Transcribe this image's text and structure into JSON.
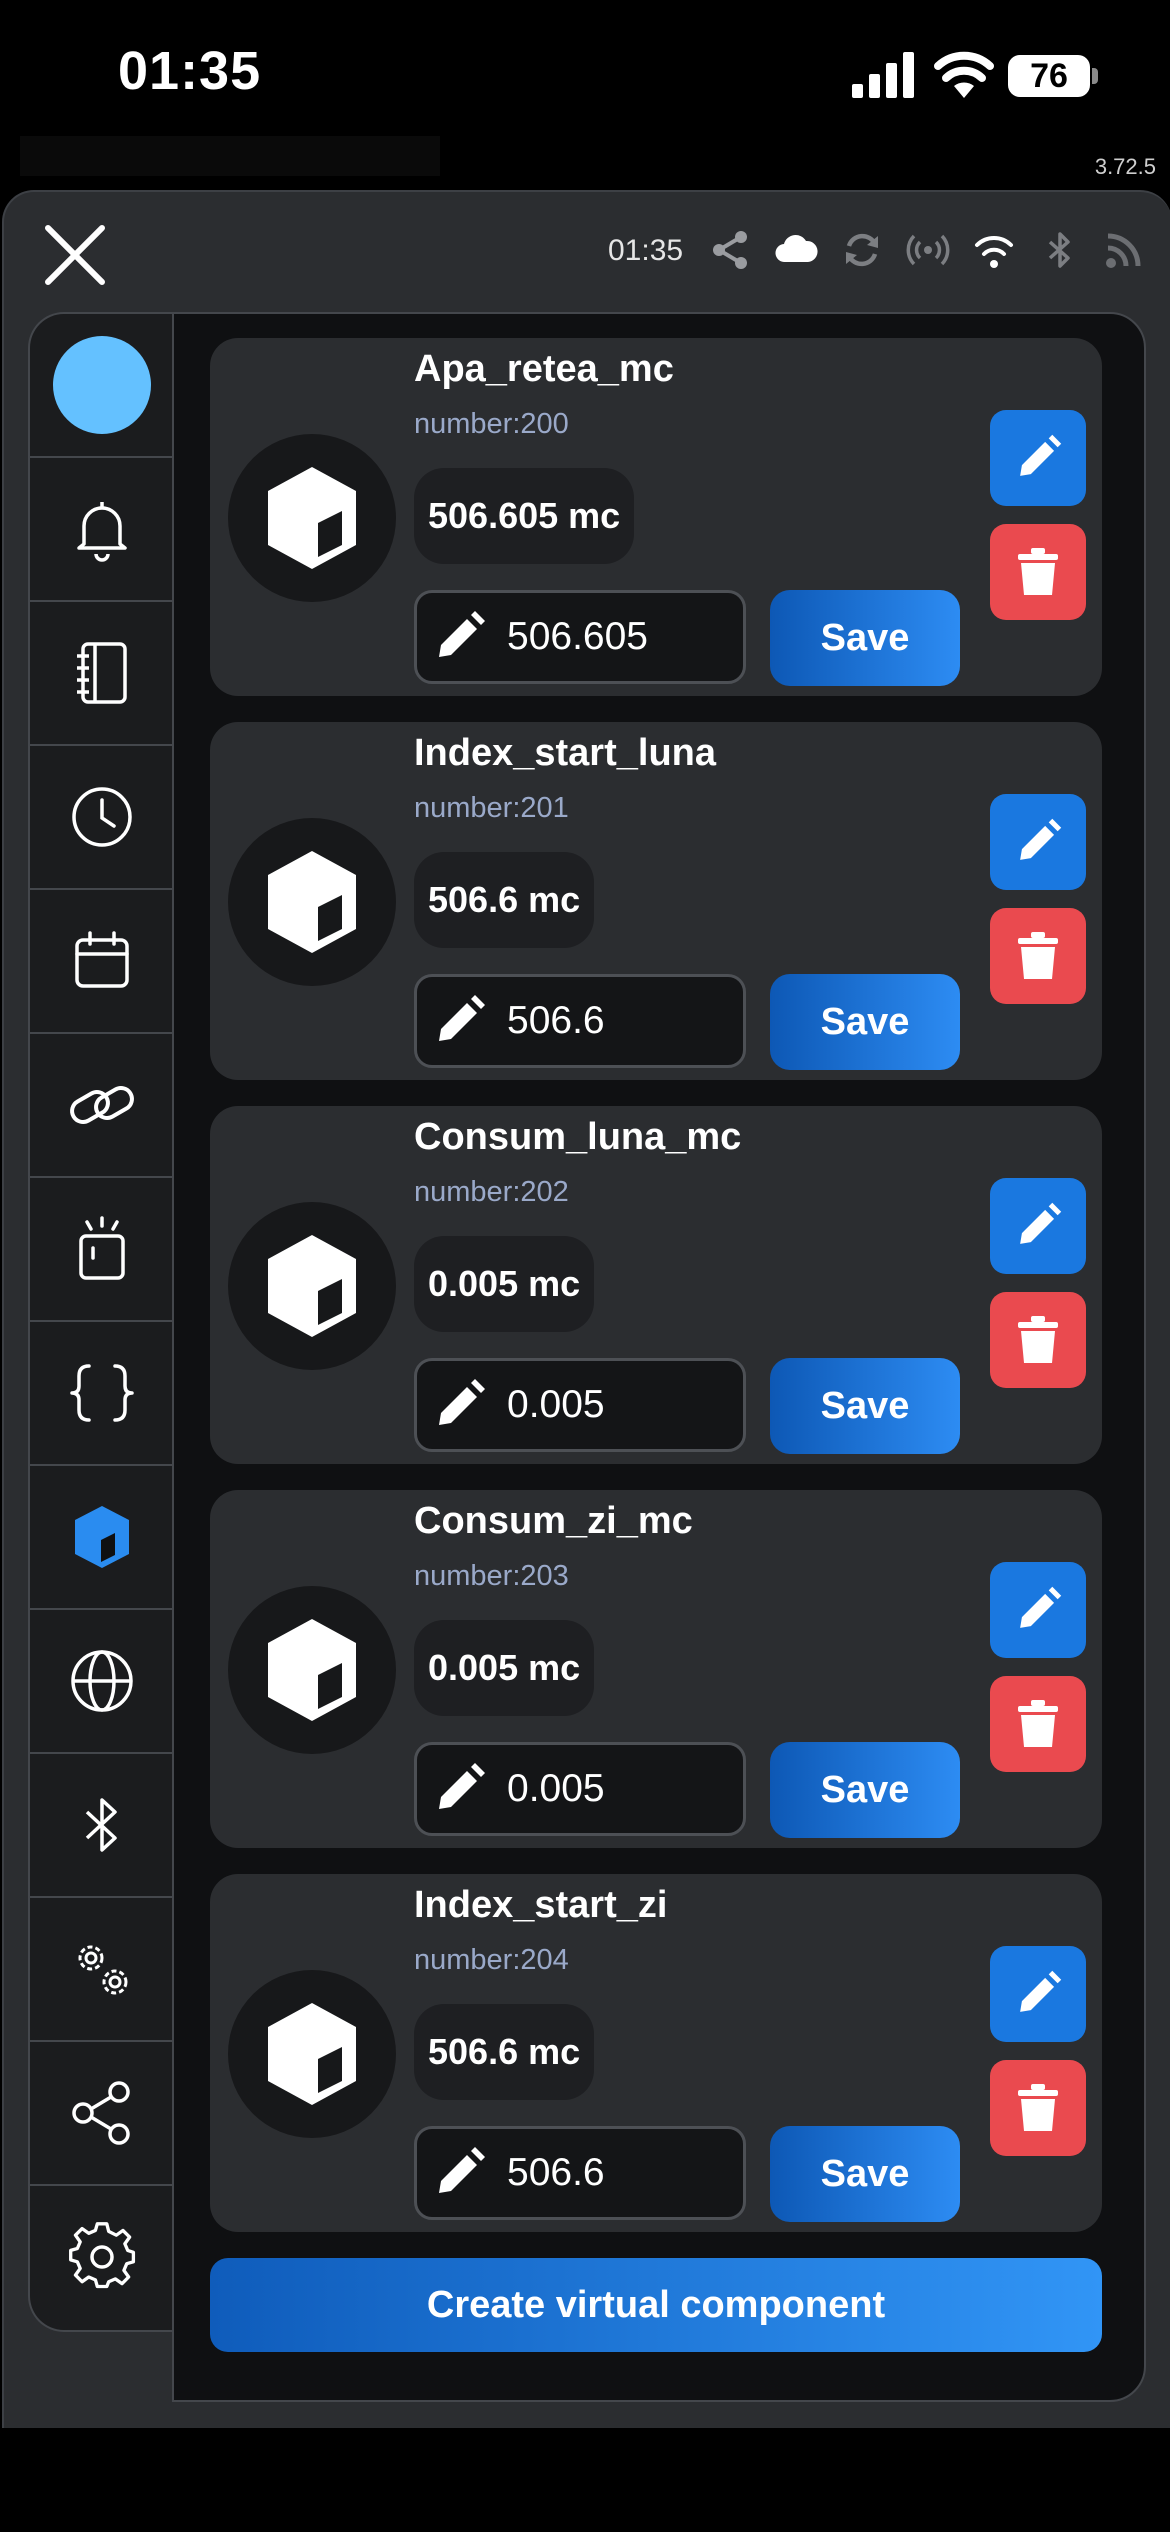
{
  "status_bar": {
    "time": "01:35",
    "battery": "76"
  },
  "version": "3.72.5",
  "header": {
    "time": "01:35"
  },
  "sidebar": {
    "items": [
      "avatar",
      "notifications",
      "log",
      "history",
      "calendar",
      "links",
      "alerts",
      "scripts",
      "virtual-components",
      "globe",
      "bluetooth",
      "advanced-settings",
      "share",
      "settings"
    ],
    "active": "virtual-components",
    "avatar_color": "#64c1ff",
    "active_color": "#2a8cf0"
  },
  "components": [
    {
      "name": "Apa_retea_mc",
      "id_label": "number:200",
      "value": "506.605 mc",
      "input": "506.605",
      "save_label": "Save"
    },
    {
      "name": "Index_start_luna",
      "id_label": "number:201",
      "value": "506.6 mc",
      "input": "506.6",
      "save_label": "Save"
    },
    {
      "name": "Consum_luna_mc",
      "id_label": "number:202",
      "value": "0.005 mc",
      "input": "0.005",
      "save_label": "Save"
    },
    {
      "name": "Consum_zi_mc",
      "id_label": "number:203",
      "value": "0.005 mc",
      "input": "0.005",
      "save_label": "Save"
    },
    {
      "name": "Index_start_zi",
      "id_label": "number:204",
      "value": "506.6 mc",
      "input": "506.6",
      "save_label": "Save"
    }
  ],
  "create_button": "Create virtual component",
  "colors": {
    "accent": "#1a78e0",
    "danger": "#ea4a4f",
    "card": "#2b2d30"
  }
}
